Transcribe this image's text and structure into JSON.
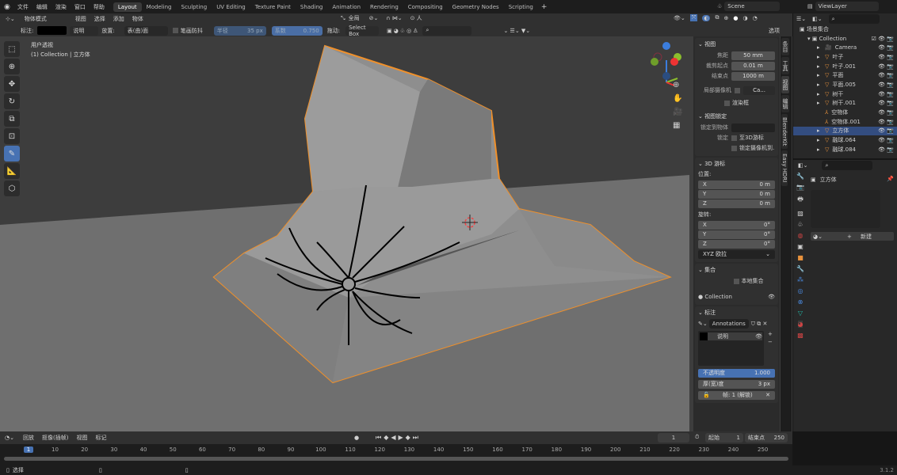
{
  "topbar": {
    "menus": [
      "文件",
      "编辑",
      "渲染",
      "窗口",
      "帮助"
    ],
    "workspaces": [
      "Layout",
      "Modeling",
      "Sculpting",
      "UV Editing",
      "Texture Paint",
      "Shading",
      "Animation",
      "Rendering",
      "Compositing",
      "Geometry Nodes",
      "Scripting"
    ],
    "active_workspace": "Layout",
    "scene": "Scene",
    "view_layer": "ViewLayer"
  },
  "header": {
    "mode": "物体模式",
    "menus": [
      "视图",
      "选择",
      "添加",
      "物体"
    ],
    "orientation": "全局",
    "options": "选项"
  },
  "tool_settings": {
    "annotation_label": "标注:",
    "layer": "说明",
    "placement_label": "放置:",
    "placement": "表(曲)面",
    "stabilize": "笔画防抖",
    "radius_label": "半径",
    "radius": "35 px",
    "factor_label": "系数",
    "factor": "0.750",
    "drag_label": "拖动:",
    "drag": "Select Box",
    "search_placeholder": ""
  },
  "viewport": {
    "view_name": "用户透视",
    "collection_info": "(1) Collection | 立方体",
    "gizmo": {
      "x": "X",
      "y": "Y",
      "z": "Z"
    }
  },
  "npanel": {
    "view": {
      "title": "视图",
      "focal_label": "焦距",
      "focal": "50 mm",
      "clip_start_label": "裁剪起点",
      "clip_start": "0.01 m",
      "clip_end_label": "结束点",
      "clip_end": "1000 m",
      "local_camera_label": "局部摄像机",
      "local_camera": "Ca...",
      "render_region": "渲染框"
    },
    "view_lock": {
      "title": "视图锁定",
      "lock_obj_label": "锁定到物体",
      "lock_label": "锁定",
      "to_3d_cursor": "至3D游标",
      "camera_to_view": "锁定摄像机到..."
    },
    "cursor": {
      "title": "3D 游标",
      "location_label": "位置:",
      "loc": [
        [
          "X",
          "0 m"
        ],
        [
          "Y",
          "0 m"
        ],
        [
          "Z",
          "0 m"
        ]
      ],
      "rotation_label": "旋转:",
      "rot": [
        [
          "X",
          "0°"
        ],
        [
          "Y",
          "0°"
        ],
        [
          "Z",
          "0°"
        ]
      ],
      "rot_mode": "XYZ 欧拉"
    },
    "collection": {
      "title": "集合",
      "local": "本地集合",
      "name": "Collection"
    },
    "annotation": {
      "title": "标注",
      "datablock": "Annotations",
      "layer": "说明",
      "opacity_label": "不透明度",
      "opacity": "1.000",
      "thickness_label": "厚(宽)度",
      "thickness": "3 px",
      "frame": "帧: 1 (解锁)"
    }
  },
  "vtabs": [
    "条目",
    "工具",
    "视图",
    "编辑",
    "BlenderKit",
    "Easy HDRI"
  ],
  "outliner": {
    "root": "场景集合",
    "collection": "Collection",
    "items": [
      {
        "name": "Camera",
        "type": "camera"
      },
      {
        "name": "叶子",
        "type": "mesh"
      },
      {
        "name": "叶子.001",
        "type": "mesh"
      },
      {
        "name": "平面",
        "type": "mesh"
      },
      {
        "name": "平面.005",
        "type": "mesh"
      },
      {
        "name": "树干",
        "type": "mesh"
      },
      {
        "name": "树干.001",
        "type": "mesh"
      },
      {
        "name": "空物体",
        "type": "empty"
      },
      {
        "name": "空物体.001",
        "type": "empty"
      },
      {
        "name": "立方体",
        "type": "mesh",
        "selected": true
      },
      {
        "name": "融球.064",
        "type": "mesh"
      },
      {
        "name": "融球.084",
        "type": "mesh"
      }
    ]
  },
  "properties": {
    "object": "立方体",
    "new_button": "新建"
  },
  "timeline": {
    "menus": [
      "回放",
      "抠像(插帧)",
      "视图",
      "标记"
    ],
    "current_frame": "1",
    "start_label": "起始",
    "start": "1",
    "end_label": "结束点",
    "end": "250",
    "ticks": [
      "1",
      "10",
      "20",
      "30",
      "40",
      "50",
      "60",
      "70",
      "80",
      "90",
      "100",
      "110",
      "120",
      "130",
      "140",
      "150",
      "160",
      "170",
      "180",
      "190",
      "200",
      "210",
      "220",
      "230",
      "240",
      "250"
    ]
  },
  "status": {
    "hint": "选择",
    "version": "3.1.2"
  },
  "colors": {
    "accent": "#4772b3",
    "selection_outline": "#f0902a",
    "annotation_stroke": "#000000"
  }
}
